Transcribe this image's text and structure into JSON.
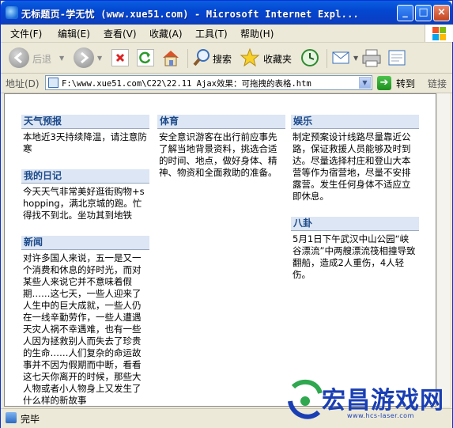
{
  "window": {
    "title": "无标题页-学无忧 (www.xue51.com) - Microsoft Internet Expl...",
    "controls": {
      "minimize": "_",
      "maximize": "□",
      "close": "×"
    }
  },
  "menu": {
    "items": [
      "文件(F)",
      "编辑(E)",
      "查看(V)",
      "收藏(A)",
      "工具(T)",
      "帮助(H)"
    ]
  },
  "toolbar": {
    "back_label": "后退",
    "search_label": "搜索",
    "favorites_label": "收藏夹",
    "icons": [
      "back-icon",
      "forward-icon",
      "stop-icon",
      "refresh-icon",
      "home-icon",
      "search-icon",
      "favorites-icon",
      "history-icon",
      "mail-icon",
      "print-icon",
      "edit-icon"
    ]
  },
  "address": {
    "label": "地址(D)",
    "value": "F:\\www.xue51.com\\C22\\22.11  Ajax效果：可拖拽的表格.htm",
    "go_label": "转到",
    "links_label": "链接"
  },
  "content": {
    "columns": [
      {
        "blocks": [
          {
            "title": "天气预报",
            "body": "本地近3天持续降温，请注意防寒"
          },
          {
            "title": "我的日记",
            "body": "今天天气非常美好逛街购物+shopping，满北京城的跑。忙得找不到北。坐功其到地铁"
          },
          {
            "title": "新闻",
            "body": "对许多国人来说，五一是又一个消费和休息的好时光，而对某些人来说它并不意味着假期……这七天，一些人迎来了人生中的巨大成就，一些人仍在一线辛勤劳作，一些人遭遇天灾人祸不幸遇难，也有一些人因为拯救别人而失去了珍贵的生命……人们复杂的命运故事并不因为假期而中断，看看这七天你离开的时候，那些大人物或者小人物身上又发生了什么样的新故事"
          }
        ]
      },
      {
        "blocks": [
          {
            "title": "体育",
            "body": "安全意识游客在出行前应事先了解当地背景资料，挑选合适的时间、地点，做好身体、精神、物资和全面救助的准备。"
          }
        ]
      },
      {
        "blocks": [
          {
            "title": "娱乐",
            "body": "制定预案设计线路尽量靠近公路，保证救援人员能够及时到达。尽量选择村庄和登山大本营等作为宿营地，尽量不安排露营。发生任何身体不适应立即休息。"
          },
          {
            "title": "八卦",
            "body": "5月1日下午武汉中山公园“峡谷漂流”中两艘漂流筏相撞导致翻船，造成2人重伤，4人轻伤。"
          }
        ]
      }
    ]
  },
  "status": {
    "text": "完毕"
  },
  "watermark": {
    "text": "宏昌游戏网",
    "url": "www.hcs-laser.com"
  }
}
